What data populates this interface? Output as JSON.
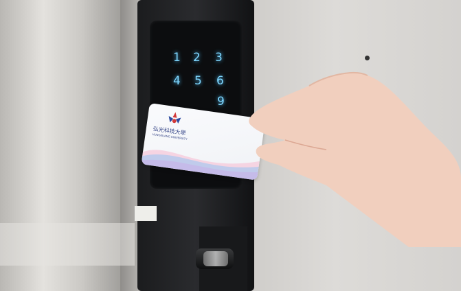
{
  "scene": {
    "keypad_digits": [
      "1",
      "2",
      "3",
      "4",
      "5",
      "6",
      "9"
    ],
    "card": {
      "university_name": "弘光科技大學",
      "university_name_en": "HUNGKUANG UNIVERSITY"
    }
  },
  "colors": {
    "wall": "#d7d5d2",
    "lock_body": "#1b1c1e",
    "key_glow": "#7fd7ff",
    "skin": "#f1cfbe"
  }
}
